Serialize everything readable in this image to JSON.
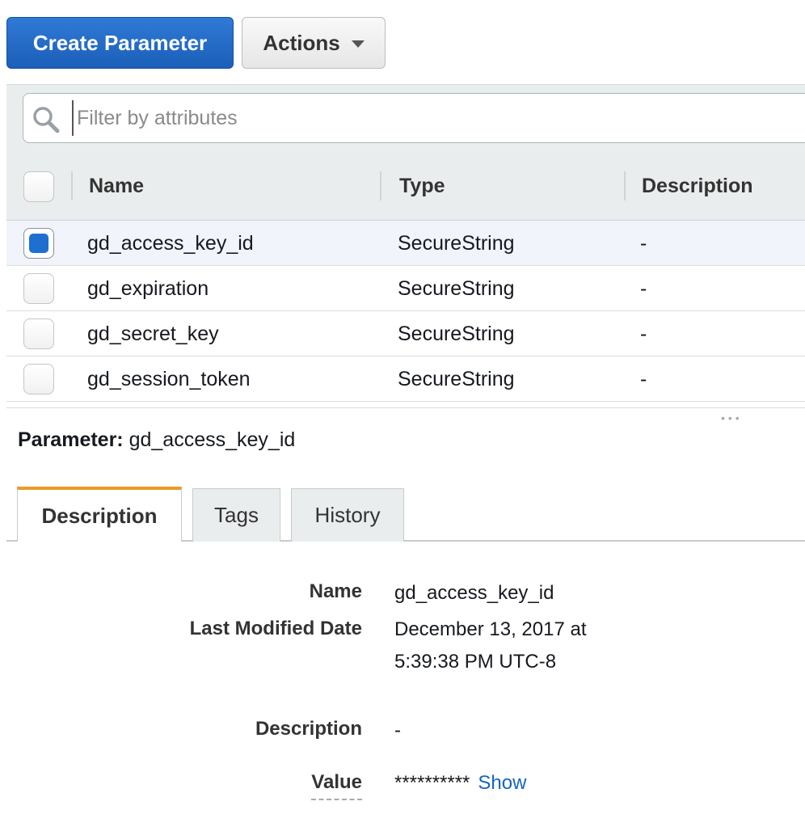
{
  "toolbar": {
    "create_label": "Create Parameter",
    "actions_label": "Actions"
  },
  "filter": {
    "placeholder": "Filter by attributes",
    "value": ""
  },
  "table": {
    "columns": [
      "Name",
      "Type",
      "Description"
    ],
    "rows": [
      {
        "name": "gd_access_key_id",
        "type": "SecureString",
        "description": "-",
        "selected": true
      },
      {
        "name": "gd_expiration",
        "type": "SecureString",
        "description": "-",
        "selected": false
      },
      {
        "name": "gd_secret_key",
        "type": "SecureString",
        "description": "-",
        "selected": false
      },
      {
        "name": "gd_session_token",
        "type": "SecureString",
        "description": "-",
        "selected": false
      }
    ]
  },
  "detail": {
    "title_label": "Parameter:",
    "title_value": "gd_access_key_id",
    "tabs": [
      "Description",
      "Tags",
      "History"
    ],
    "active_tab": "Description",
    "fields": {
      "name_label": "Name",
      "name_value": "gd_access_key_id",
      "modified_label": "Last Modified Date",
      "modified_line1": "December 13, 2017 at",
      "modified_line2": "5:39:38 PM UTC-8",
      "description_label": "Description",
      "description_value": "-",
      "value_label": "Value",
      "value_masked": "**********",
      "show_link": "Show"
    }
  },
  "colors": {
    "primary": "#1f6fd1",
    "active_tab_accent": "#ec9a27",
    "link": "#1565c0"
  }
}
